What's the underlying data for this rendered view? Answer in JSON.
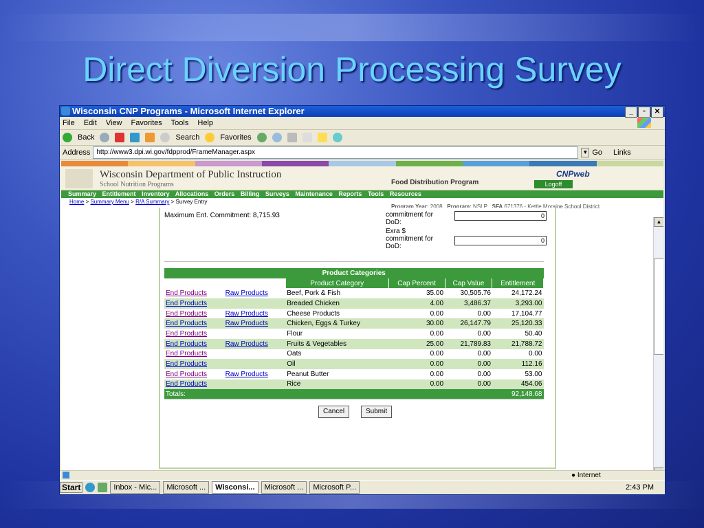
{
  "slide": {
    "title": "Direct Diversion Processing Survey"
  },
  "window": {
    "title": "Wisconsin CNP Programs - Microsoft Internet Explorer"
  },
  "menu": [
    "File",
    "Edit",
    "View",
    "Favorites",
    "Tools",
    "Help"
  ],
  "toolbar": {
    "back": "Back",
    "search": "Search",
    "favorites": "Favorites"
  },
  "address": {
    "label": "Address",
    "url": "http://www3.dpi.wi.gov/fdpprod/FrameManager.aspx",
    "go": "Go",
    "links": "Links"
  },
  "header": {
    "org": "Wisconsin Department of Public Instruction",
    "sub": "School Nutrition Programs",
    "program": "Food Distribution Program",
    "logoff": "Logoff",
    "cnp": "CNPweb"
  },
  "nav": [
    "Summary",
    "Entitlement",
    "Inventory",
    "Allocations",
    "Orders",
    "Billing",
    "Surveys",
    "Maintenance",
    "Reports",
    "Tools",
    "Resources"
  ],
  "breadcrumb": [
    "Home",
    "Summary Menu",
    "R/A Summary",
    "Survey Entry"
  ],
  "program_info": {
    "year_label": "Program Year:",
    "year": "2008",
    "program_label": "Program:",
    "program": "NSLP",
    "sfa_label": "SFA",
    "sfa": "671376 - Kettle Moraine School District"
  },
  "commitment": {
    "max_ent": "Maximum Ent. Commitment: 8,715.93",
    "line1": "commitment for",
    "line2": "DoD:",
    "value1": "0",
    "extra": [
      "Exra $",
      "commitment for",
      "DoD:"
    ],
    "value2": "0"
  },
  "table": {
    "title": "Product Categories",
    "headers": [
      "Product Category",
      "Cap Percent",
      "Cap Value",
      "Entitlement"
    ],
    "rows": [
      {
        "end": "End Products",
        "raw": "Raw Products",
        "cat": "Beef, Pork & Fish",
        "pct": "35.00",
        "val": "30,505.76",
        "ent": "24,172.24"
      },
      {
        "end": "End Products",
        "raw": "",
        "cat": "Breaded Chicken",
        "pct": "4.00",
        "val": "3,486.37",
        "ent": "3,293.00"
      },
      {
        "end": "End Products",
        "raw": "Raw Products",
        "cat": "Cheese Products",
        "pct": "0.00",
        "val": "0.00",
        "ent": "17,104.77"
      },
      {
        "end": "End Products",
        "raw": "Raw Products",
        "cat": "Chicken, Eggs & Turkey",
        "pct": "30.00",
        "val": "26,147.79",
        "ent": "25,120.33"
      },
      {
        "end": "End Products",
        "raw": "",
        "cat": "Flour",
        "pct": "0.00",
        "val": "0.00",
        "ent": "50.40"
      },
      {
        "end": "End Products",
        "raw": "Raw Products",
        "cat": "Fruits & Vegetables",
        "pct": "25.00",
        "val": "21,789.83",
        "ent": "21,788.72"
      },
      {
        "end": "End Products",
        "raw": "",
        "cat": "Oats",
        "pct": "0.00",
        "val": "0.00",
        "ent": "0.00"
      },
      {
        "end": "End Products",
        "raw": "",
        "cat": "Oil",
        "pct": "0.00",
        "val": "0.00",
        "ent": "112.16"
      },
      {
        "end": "End Products",
        "raw": "Raw Products",
        "cat": "Peanut Butter",
        "pct": "0.00",
        "val": "0.00",
        "ent": "53.00"
      },
      {
        "end": "End Products",
        "raw": "",
        "cat": "Rice",
        "pct": "0.00",
        "val": "0.00",
        "ent": "454.06"
      }
    ],
    "totals_label": "Totals:",
    "totals_value": "92,148.68"
  },
  "buttons": {
    "cancel": "Cancel",
    "submit": "Submit"
  },
  "status": {
    "zone": "Internet"
  },
  "taskbar": {
    "start": "Start",
    "tasks": [
      "Inbox - Mic...",
      "Microsoft ...",
      "Wisconsi...",
      "Microsoft ...",
      "Microsoft P..."
    ],
    "clock": "2:43 PM"
  }
}
